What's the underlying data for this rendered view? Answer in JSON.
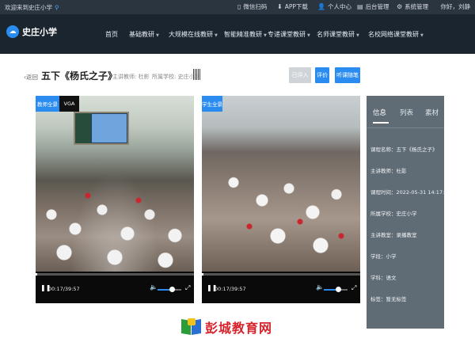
{
  "topbar": {
    "welcome": "欢迎来到史庄小学",
    "wechat": "微信扫码",
    "app": "APP下载",
    "personal": "个人中心",
    "backend": "后台管理",
    "system": "系统管理",
    "user": "你好，刘静"
  },
  "nav": {
    "logo": "史庄小学",
    "items": [
      {
        "label": "首页",
        "has_caret": false
      },
      {
        "label": "基础教研",
        "has_caret": true
      },
      {
        "label": "大规模在线教研",
        "has_caret": true
      },
      {
        "label": "智能精准教研",
        "has_caret": true
      },
      {
        "label": "专递课堂教研",
        "has_caret": true
      },
      {
        "label": "名师课堂教研",
        "has_caret": true
      },
      {
        "label": "名校网络课堂教研",
        "has_caret": true
      }
    ]
  },
  "lesson": {
    "back": "返回",
    "title": "五下《杨氏之子》",
    "teacher_meta": "主讲教师: 杜影",
    "school_meta": "所属学校: 史庄小学",
    "btn_done": "已评入",
    "btn_eval": "评价",
    "btn_note": "听课随笔"
  },
  "videos": [
    {
      "tags": [
        "教师全景",
        "VGA"
      ],
      "time": "00:17/39:57",
      "progress": 0.01,
      "volume": 0.6
    },
    {
      "tags": [
        "学生全景"
      ],
      "time": "00:17/39:57",
      "progress": 0.01,
      "volume": 0.6
    }
  ],
  "info": {
    "tabs": [
      "信息",
      "列表",
      "素材"
    ],
    "rows": [
      "课程名称：五下《杨氏之子》",
      "主讲教师：杜影",
      "课程时间：2022-05-31 14:17:0...",
      "所属学校：史庄小学",
      "主讲教室：录播教室",
      "学段：小学",
      "学科：语文",
      "标签：暂无标签"
    ]
  },
  "footer": {
    "text": "彭城教育网"
  },
  "colors": {
    "accent": "#2a8cf0",
    "topbar": "#2b3540",
    "nav": "#1a2530",
    "info_panel": "#5f6b75",
    "footer_text": "#d6232b"
  }
}
